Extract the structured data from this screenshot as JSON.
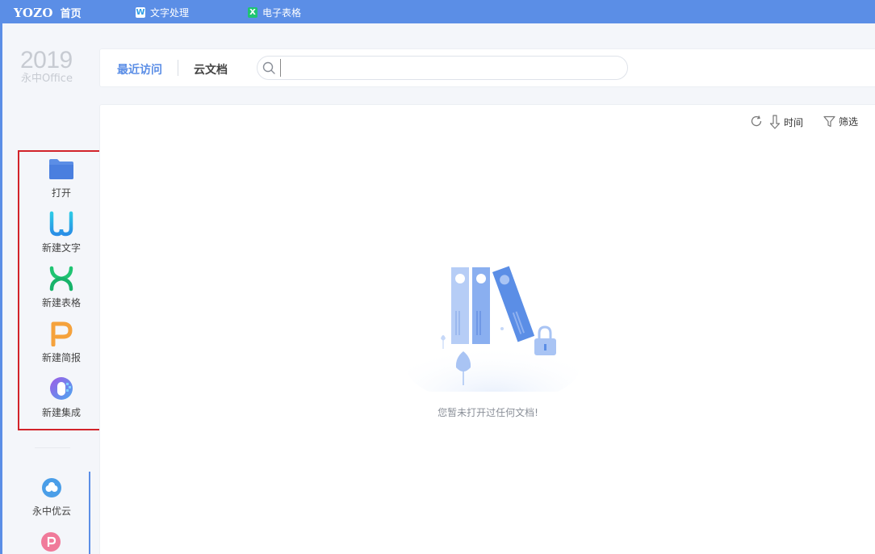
{
  "topbar": {
    "logo": "YOZO",
    "home": "首页",
    "tabs": [
      {
        "icon": "word-doc-icon",
        "glyph": "W",
        "label": "文字处理"
      },
      {
        "icon": "spreadsheet-icon",
        "glyph": "X",
        "label": "电子表格"
      }
    ],
    "color": "#5b8ee6"
  },
  "sidebar": {
    "version_year": "2019",
    "version_name": "永中Office",
    "actions": [
      {
        "label": "打开",
        "icon": "folder-icon",
        "color": "#5b8ee6"
      },
      {
        "label": "新建文字",
        "icon": "new-document-icon",
        "color": "#29b6e8"
      },
      {
        "label": "新建表格",
        "icon": "new-spreadsheet-icon",
        "color": "#1fc472"
      },
      {
        "label": "新建简报",
        "icon": "new-presentation-icon",
        "color": "#f5a23c"
      },
      {
        "label": "新建集成",
        "icon": "new-integrated-icon",
        "color": "#8a63e6"
      }
    ],
    "cloud": {
      "label": "永中优云",
      "icon": "yozo-cloud-icon"
    },
    "pdf": {
      "icon": "pdf-icon",
      "glyph": "P"
    }
  },
  "header": {
    "tab_recent": "最近访问",
    "tab_cloud": "云文档",
    "search_value": ""
  },
  "toolbar": {
    "sort_label": "时间",
    "filter_label": "筛选"
  },
  "empty_state": {
    "message": "您暂未打开过任何文档!"
  }
}
